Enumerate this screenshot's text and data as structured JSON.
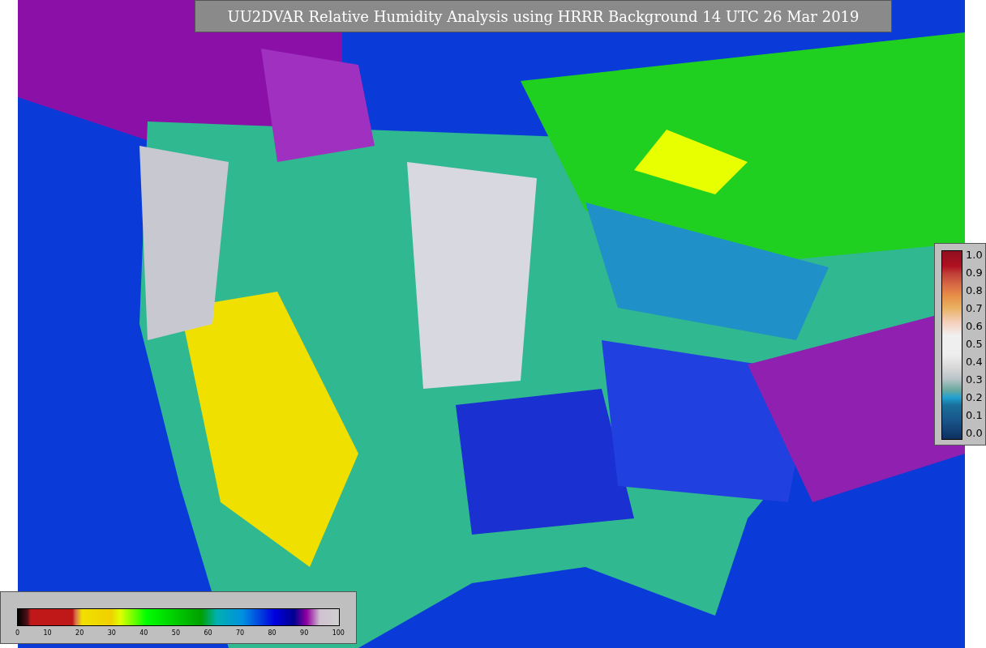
{
  "title": "UU2DVAR Relative Humidity Analysis using HRRR Background 14 UTC 26 Mar 2019",
  "side_colorbar": {
    "ticks": [
      "1.0",
      "0.9",
      "0.8",
      "0.7",
      "0.6",
      "0.5",
      "0.4",
      "0.3",
      "0.2",
      "0.1",
      "0.0"
    ]
  },
  "bottom_colorbar": {
    "ticks": [
      "0",
      "10",
      "20",
      "30",
      "40",
      "50",
      "60",
      "70",
      "80",
      "90",
      "100"
    ]
  }
}
